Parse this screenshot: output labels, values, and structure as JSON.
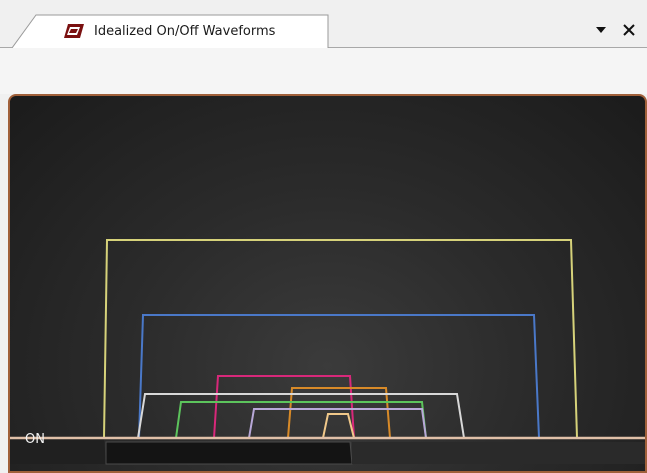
{
  "window": {
    "tab_title": "Idealized On/Off Waveforms",
    "tab_icon": "ltspice-waveform-icon",
    "dropdown_icon": "dropdown-arrow-icon",
    "close_icon": "close-icon"
  },
  "plot": {
    "state_label": "ON",
    "colors": {
      "background": "#232323",
      "border": "#a0603a",
      "baseline": "#e0c0a8",
      "gate_fill": "#1a1a1a"
    },
    "traces": [
      {
        "name": "yellow",
        "color": "#d6d27a"
      },
      {
        "name": "blue",
        "color": "#4a78c8"
      },
      {
        "name": "magenta",
        "color": "#d8287a"
      },
      {
        "name": "orange",
        "color": "#d88a28"
      },
      {
        "name": "white",
        "color": "#d8d8d8"
      },
      {
        "name": "green",
        "color": "#5cc45c"
      },
      {
        "name": "lavender",
        "color": "#b8a8d8"
      },
      {
        "name": "peach",
        "color": "#f0c88a"
      }
    ]
  }
}
